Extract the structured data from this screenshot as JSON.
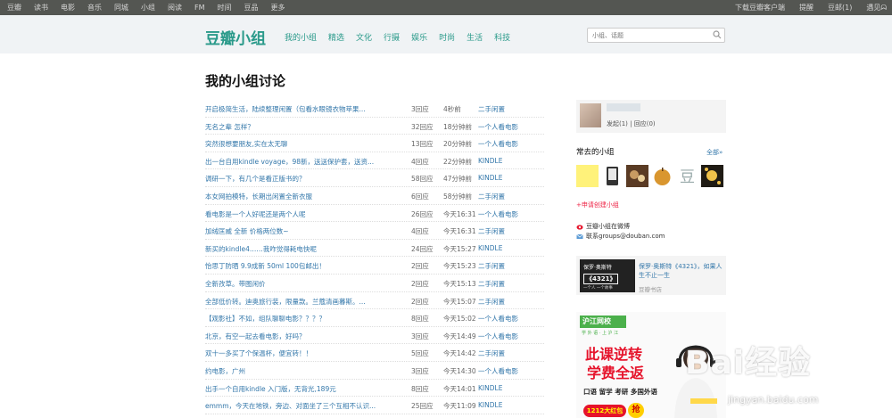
{
  "topbar": {
    "left_links": [
      "豆瓣",
      "读书",
      "电影",
      "音乐",
      "同城",
      "小组",
      "阅读",
      "FM",
      "时间",
      "豆品",
      "更多"
    ],
    "right_links": [
      "下载豆瓣客户端",
      "提醒",
      "豆邮(1)",
      "遇见ᗣ"
    ]
  },
  "header": {
    "logo": "豆瓣小组",
    "nav": [
      "我的小组",
      "精选",
      "文化",
      "行摄",
      "娱乐",
      "时尚",
      "生活",
      "科技"
    ],
    "search_placeholder": "小组、话题"
  },
  "page_title": "我的小组讨论",
  "topics": [
    {
      "title": "开启极简生活，陆续整理闲置（包看水眼镜衣物苹果...",
      "replies": "3回应",
      "time": "4秒前",
      "group": "二手闲置"
    },
    {
      "title": "无名之辈 怎样？",
      "replies": "32回应",
      "time": "18分钟前",
      "group": "一个人看电影"
    },
    {
      "title": "突然很想要朋友,实在太无聊",
      "replies": "13回应",
      "time": "20分钟前",
      "group": "一个人看电影"
    },
    {
      "title": "出一台自用kindle voyage，98新，送送保护套，送资...",
      "replies": "4回应",
      "time": "22分钟前",
      "group": "KINDLE"
    },
    {
      "title": "调研一下，有几个是看正版书的？",
      "replies": "58回应",
      "time": "47分钟前",
      "group": "KINDLE"
    },
    {
      "title": "本女网拍模特，长期出闲置全新衣服",
      "replies": "6回应",
      "time": "58分钟前",
      "group": "二手闲置"
    },
    {
      "title": "看电影是一个人好呢还是两个人呢",
      "replies": "26回应",
      "time": "今天16:31",
      "group": "一个人看电影"
    },
    {
      "title": "加绒匡威 全新 价格两位数~",
      "replies": "4回应",
      "time": "今天16:31",
      "group": "二手闲置"
    },
    {
      "title": "新买的kindle4……我咋觉得耗电快呢",
      "replies": "24回应",
      "time": "今天15:27",
      "group": "KINDLE"
    },
    {
      "title": "怡思丁防晒 9.9成新 50ml 100包邮出！",
      "replies": "2回应",
      "time": "今天15:23",
      "group": "二手闲置"
    },
    {
      "title": "全新孜草。带图闲价",
      "replies": "2回应",
      "time": "今天15:13",
      "group": "二手闲置"
    },
    {
      "title": "全部低价转。迪奥旅行装，限量款。兰蔻清画暮斯。...",
      "replies": "2回应",
      "time": "今天15:07",
      "group": "二手闲置"
    },
    {
      "title": "【观影社】不如，组队聊聊电影？？？？",
      "replies": "8回应",
      "time": "今天15:02",
      "group": "一个人看电影"
    },
    {
      "title": "北京，有空一起去看电影，好吗？",
      "replies": "3回应",
      "time": "今天14:49",
      "group": "一个人看电影"
    },
    {
      "title": "双十一多买了个保温杯，便宜转！！",
      "replies": "5回应",
      "time": "今天14:42",
      "group": "二手闲置"
    },
    {
      "title": "约电影，广州",
      "replies": "3回应",
      "time": "今天14:30",
      "group": "一个人看电影"
    },
    {
      "title": "出手一个自用kindle 入门版，无背光,189元",
      "replies": "8回应",
      "time": "今天14:01",
      "group": "KINDLE"
    },
    {
      "title": "emmm，今天在地铁，旁边、对面坐了三个互相不认识...",
      "replies": "25回应",
      "time": "今天11:09",
      "group": "KINDLE"
    }
  ],
  "profile": {
    "posts": "发起(1)",
    "replies": "回应(0)"
  },
  "frequent": {
    "title": "常去的小组",
    "all": "全部»",
    "apply": "+申请创建小组"
  },
  "contact": {
    "weibo": "豆瓣小组在微博",
    "email": "联系groups@douban.com"
  },
  "ad_book": {
    "cover_title": "保罗·奥斯特",
    "cover_num": "《4321》",
    "cover_sub": "一个人 一个故事",
    "text": "保罗·奥斯特《4321》，如果人生不止一生",
    "source": "豆瓣书店"
  },
  "ad_hujiang": {
    "brand": "沪江网校",
    "sub": "学 外 语 · 上 沪 江",
    "line1": "此课逆转",
    "line2": "学费全返",
    "courses": "口语 留学 考研 多国外语",
    "promo": "1212大红包",
    "grab": "抢"
  },
  "watermark": {
    "brand": "Bai经验",
    "url": "jingyan.baidu.com"
  },
  "colors": {
    "accent": "#2a9a8a",
    "link": "#3377aa",
    "topbar": "#545652",
    "ad_red": "#e6132b"
  }
}
